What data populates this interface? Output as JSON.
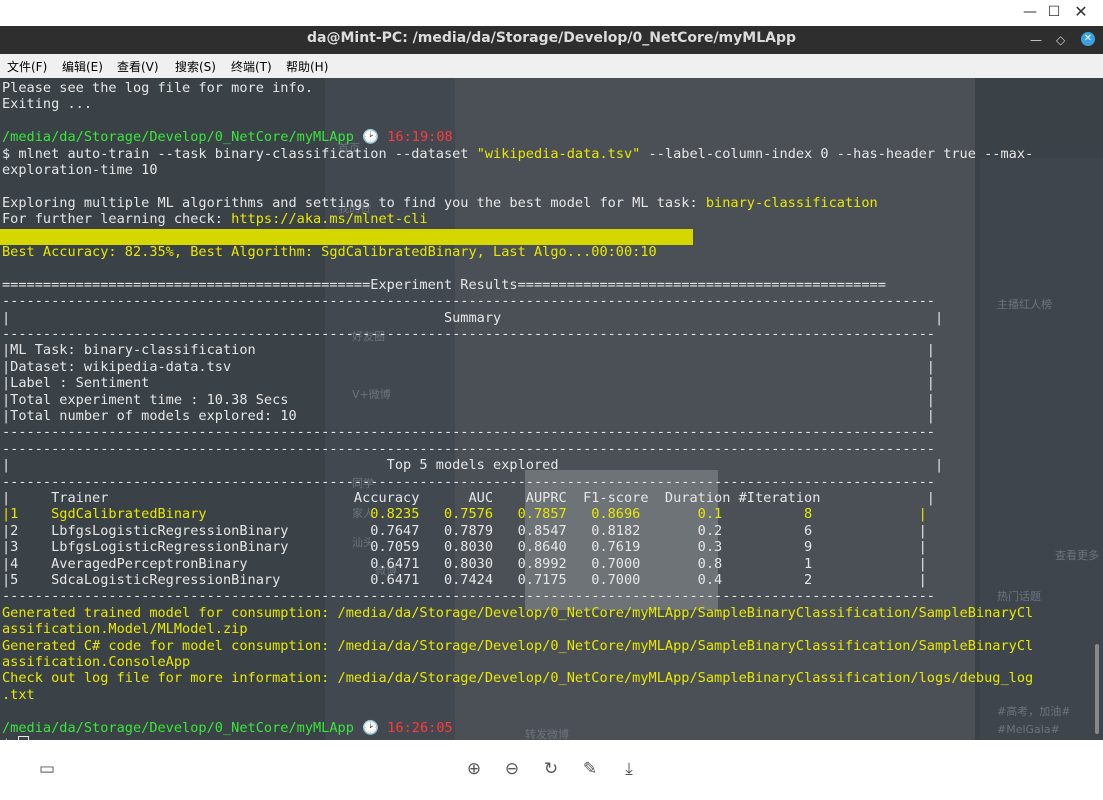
{
  "viewer": {
    "min_glyph": "—",
    "max_glyph": "☐",
    "close_glyph": "✕"
  },
  "terminal_window": {
    "title": "da@Mint-PC: /media/da/Storage/Develop/0_NetCore/myMLApp",
    "close_glyph": "✕",
    "min_glyph": "—",
    "max_glyph": "◇"
  },
  "menu": [
    "文件(F)",
    "编辑(E)",
    "查看(V)",
    "搜索(S)",
    "终端(T)",
    "帮助(H)"
  ],
  "terminal": {
    "lines": [
      {
        "t": "Please see the log file for more info."
      },
      {
        "t": "Exiting ..."
      },
      {
        "t": ""
      },
      {
        "segs": [
          {
            "t": "/media/da/Storage/Develop/0_NetCore/myMLApp",
            "c": "green"
          },
          {
            "t": " 🕑 ",
            "c": "white"
          },
          {
            "t": "16:19:08",
            "c": "red"
          }
        ]
      },
      {
        "segs": [
          {
            "t": "$ mlnet auto-train --task binary-classification --dataset ",
            "c": "white"
          },
          {
            "t": "\"wikipedia-data.tsv\"",
            "c": "yellow"
          },
          {
            "t": " --label-column-index 0 --has-header true --max-",
            "c": "white"
          }
        ]
      },
      {
        "t": "exploration-time 10"
      },
      {
        "t": ""
      },
      {
        "segs": [
          {
            "t": "Exploring multiple ML algorithms and settings to find you the best model for ML task: ",
            "c": "white"
          },
          {
            "t": "binary-classification",
            "c": "yellow"
          }
        ]
      },
      {
        "segs": [
          {
            "t": "For further learning check: ",
            "c": "white"
          },
          {
            "t": "https://aka.ms/mlnet-cli",
            "c": "yellow"
          }
        ]
      },
      {
        "t": "",
        "progress": true
      },
      {
        "segs": [
          {
            "t": "Best Accuracy: 82.35%, Best Algorithm: SgdCalibratedBinary, Last Algo...00:00:10",
            "c": "yellow"
          }
        ]
      },
      {
        "t": ""
      },
      {
        "t": "=============================================Experiment Results============================================="
      },
      {
        "t": "------------------------------------------------------------------------------------------------------------------"
      },
      {
        "t": "|                                                     Summary                                                     |"
      },
      {
        "t": "------------------------------------------------------------------------------------------------------------------"
      },
      {
        "t": "|ML Task: binary-classification                                                                                  |"
      },
      {
        "t": "|Dataset: wikipedia-data.tsv                                                                                     |"
      },
      {
        "t": "|Label : Sentiment                                                                                               |"
      },
      {
        "t": "|Total experiment time : 10.38 Secs                                                                              |"
      },
      {
        "t": "|Total number of models explored: 10                                                                             |"
      },
      {
        "t": "------------------------------------------------------------------------------------------------------------------"
      },
      {
        "t": "------------------------------------------------------------------------------------------------------------------"
      },
      {
        "t": "|                                              Top 5 models explored                                              |"
      },
      {
        "t": "------------------------------------------------------------------------------------------------------------------"
      },
      {
        "t": "|     Trainer                              Accuracy      AUC    AUPRC  F1-score  Duration #Iteration             |"
      },
      {
        "segs": [
          {
            "t": "|1    SgdCalibratedBinary                    0.8235   0.7576   0.7857   0.8696       0.1          8             |",
            "c": "yellow"
          }
        ]
      },
      {
        "t": "|2    LbfgsLogisticRegressionBinary          0.7647   0.7879   0.8547   0.8182       0.2          6             |"
      },
      {
        "t": "|3    LbfgsLogisticRegressionBinary          0.7059   0.8030   0.8640   0.7619       0.3          9             |"
      },
      {
        "t": "|4    AveragedPerceptronBinary               0.6471   0.8030   0.8992   0.7000       0.8          1             |"
      },
      {
        "t": "|5    SdcaLogisticRegressionBinary           0.6471   0.7424   0.7175   0.7000       0.4          2             |"
      },
      {
        "t": "------------------------------------------------------------------------------------------------------------------"
      },
      {
        "segs": [
          {
            "t": "Generated trained model for consumption: /media/da/Storage/Develop/0_NetCore/myMLApp/SampleBinaryClassification/SampleBinaryCl",
            "c": "yellow"
          }
        ]
      },
      {
        "segs": [
          {
            "t": "assification.Model/MLModel.zip",
            "c": "yellow"
          }
        ]
      },
      {
        "segs": [
          {
            "t": "Generated C# code for model consumption: /media/da/Storage/Develop/0_NetCore/myMLApp/SampleBinaryClassification/SampleBinaryCl",
            "c": "yellow"
          }
        ]
      },
      {
        "segs": [
          {
            "t": "assification.ConsoleApp",
            "c": "yellow"
          }
        ]
      },
      {
        "segs": [
          {
            "t": "Check out log file for more information: /media/da/Storage/Develop/0_NetCore/myMLApp/SampleBinaryClassification/logs/debug_log",
            "c": "yellow"
          }
        ]
      },
      {
        "segs": [
          {
            "t": ".txt",
            "c": "yellow"
          }
        ]
      },
      {
        "t": ""
      },
      {
        "segs": [
          {
            "t": "/media/da/Storage/Develop/0_NetCore/myMLApp",
            "c": "green"
          },
          {
            "t": " 🕑 ",
            "c": "white"
          },
          {
            "t": "16:26:05",
            "c": "red"
          }
        ]
      },
      {
        "t": "$ ",
        "cursor": true
      }
    ]
  },
  "background_page": {
    "texts": [
      "首页",
      "我的赞",
      "好友圈",
      "V+微博",
      "同学",
      "家人",
      "汕头",
      "微博",
      "热门话题",
      "主播红人榜",
      "查看更多",
      "转发微博",
      "#高考，加油#",
      "#MelGala#"
    ]
  },
  "toolbar": {
    "panel_icon": "▭",
    "zoom_in_icon": "⊕",
    "zoom_out_icon": "⊖",
    "rotate_icon": "↻",
    "edit_icon": "✎",
    "download_icon": "⤓"
  }
}
